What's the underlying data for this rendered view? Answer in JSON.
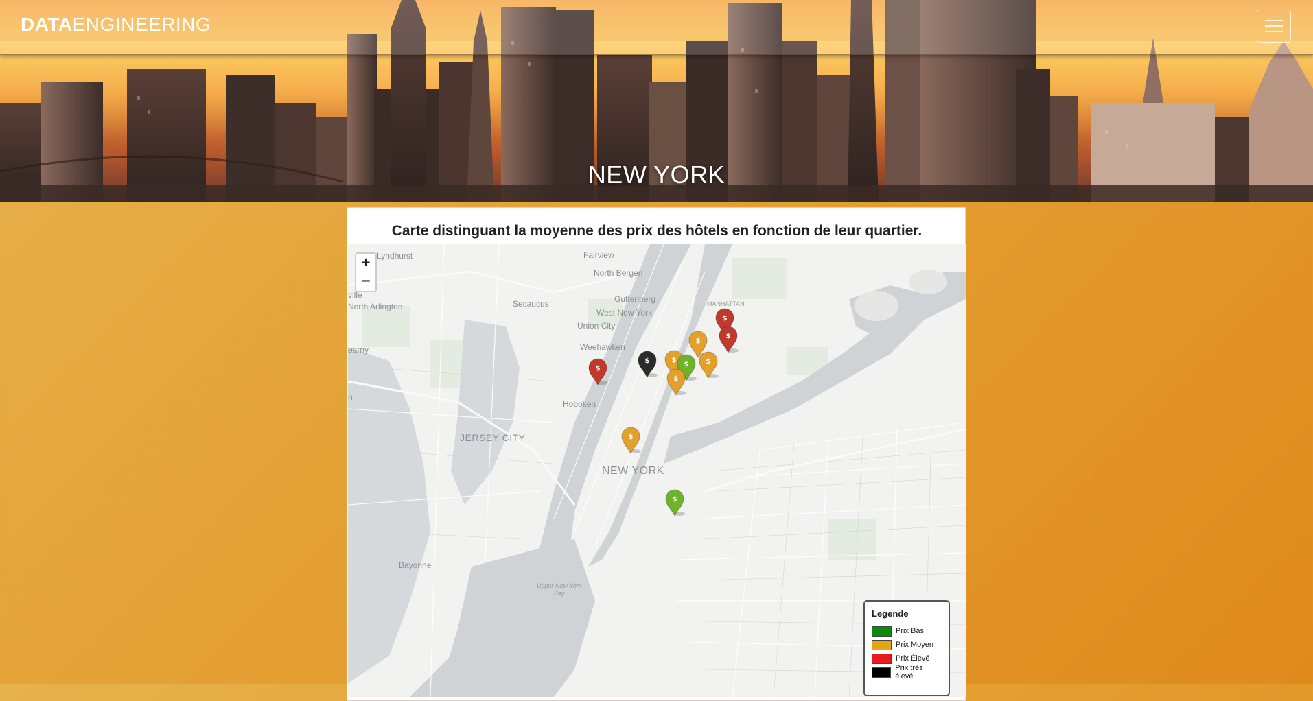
{
  "header": {
    "brand_bold": "DATA",
    "brand_light": "ENGINEERING",
    "menu_icon": "hamburger-icon",
    "title": "NEW YORK"
  },
  "panel": {
    "title": "Carte distinguant la moyenne des prix des hôtels en fonction de leur quartier."
  },
  "map": {
    "zoom_in": "+",
    "zoom_out": "−",
    "labels": {
      "lyndhurst": "Lyndhurst",
      "fairview": "Fairview",
      "north_bergen": "North Bergen",
      "ville": "ville",
      "north_arlington": "North Arlington",
      "secaucus": "Secaucus",
      "guttenberg": "Guttenberg",
      "manhattan": "MANHATTAN",
      "west_new_york": "West New York",
      "union_city": "Union City",
      "kearny": "earny",
      "weehawken": "Weehawken",
      "hoboken": "Hoboken",
      "jersey_city": "JERSEY CITY",
      "new_york": "NEW YORK",
      "bayonne": "Bayonne",
      "upper_bay_1": "Upper New York",
      "upper_bay_2": "Bay",
      "n_edge": "n"
    },
    "markers": [
      {
        "category": "eleve",
        "color": "#c0392b"
      },
      {
        "category": "eleve",
        "color": "#c0392b"
      },
      {
        "category": "moyen",
        "color": "#e3a02b"
      },
      {
        "category": "eleve",
        "color": "#c0392b"
      },
      {
        "category": "tres_eleve",
        "color": "#2b2b2b"
      },
      {
        "category": "moyen",
        "color": "#e3a02b"
      },
      {
        "category": "bas",
        "color": "#6fb32a"
      },
      {
        "category": "moyen",
        "color": "#e3a02b"
      },
      {
        "category": "moyen",
        "color": "#e3a02b"
      },
      {
        "category": "moyen",
        "color": "#e3a02b"
      },
      {
        "category": "bas",
        "color": "#6fb32a"
      }
    ]
  },
  "legend": {
    "title": "Legende",
    "items": [
      {
        "label": "Prix Bas",
        "color": "#0c8a0c"
      },
      {
        "label": "Prix Moyen",
        "color": "#e3a514"
      },
      {
        "label": "Prix Élevé",
        "color": "#e81c1c"
      },
      {
        "label": "Prix très élevé",
        "color": "#000000"
      }
    ]
  }
}
